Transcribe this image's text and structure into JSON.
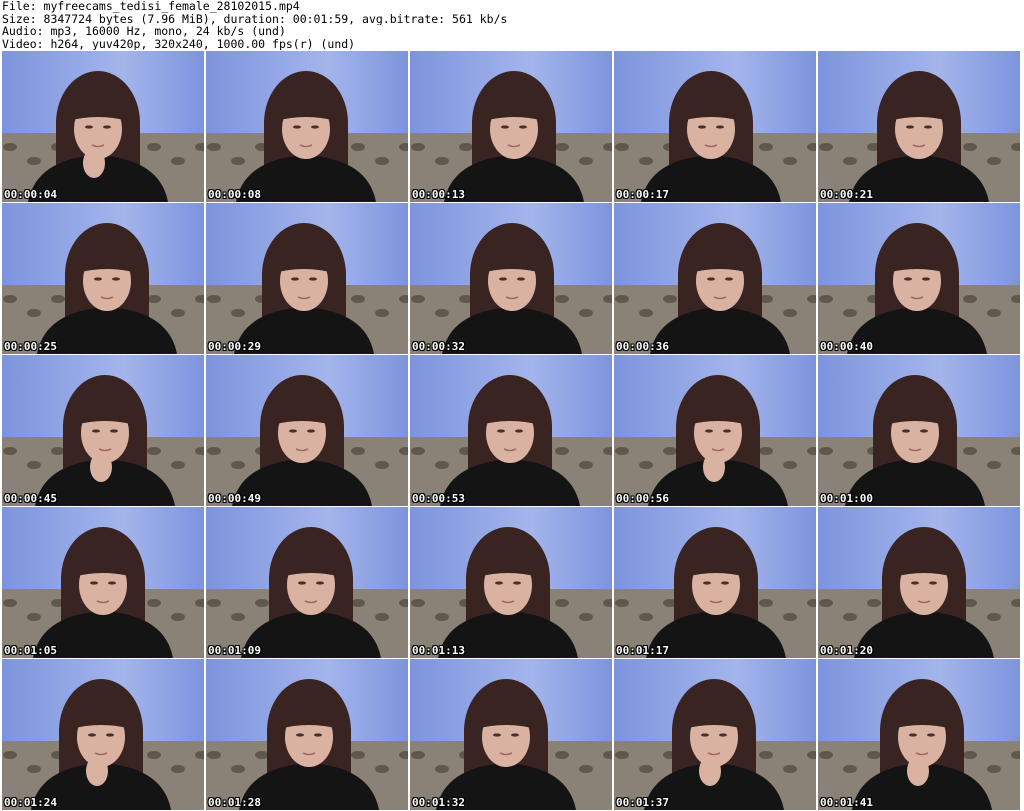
{
  "header": {
    "file_line": "File: myfreecams_tedisi_female_28102015.mp4",
    "size_line": "Size: 8347724 bytes (7.96 MiB), duration: 00:01:59, avg.bitrate: 561 kb/s",
    "audio_line": "Audio: mp3, 16000 Hz, mono, 24 kb/s (und)",
    "video_line": "Video: h264, yuv420p, 320x240, 1000.00 fps(r) (und)"
  },
  "colors": {
    "wall": "#7d94dd",
    "wall_light": "#a4b5ec",
    "hair": "#3a2422",
    "skin": "#d9b2a2",
    "shirt": "#141414",
    "sofa": "#8a8276",
    "sofa_pattern": "#4e463e",
    "timestamp": "#ffffff"
  },
  "thumbnails": [
    {
      "time": "00:00:04",
      "hand": true
    },
    {
      "time": "00:00:08",
      "hand": false
    },
    {
      "time": "00:00:13",
      "hand": false
    },
    {
      "time": "00:00:17",
      "hand": false
    },
    {
      "time": "00:00:21",
      "hand": false
    },
    {
      "time": "00:00:25",
      "hand": false
    },
    {
      "time": "00:00:29",
      "hand": false
    },
    {
      "time": "00:00:32",
      "hand": false
    },
    {
      "time": "00:00:36",
      "hand": false
    },
    {
      "time": "00:00:40",
      "hand": false
    },
    {
      "time": "00:00:45",
      "hand": true
    },
    {
      "time": "00:00:49",
      "hand": false
    },
    {
      "time": "00:00:53",
      "hand": false
    },
    {
      "time": "00:00:56",
      "hand": true
    },
    {
      "time": "00:01:00",
      "hand": false
    },
    {
      "time": "00:01:05",
      "hand": false
    },
    {
      "time": "00:01:09",
      "hand": false
    },
    {
      "time": "00:01:13",
      "hand": false
    },
    {
      "time": "00:01:17",
      "hand": false
    },
    {
      "time": "00:01:20",
      "hand": false
    },
    {
      "time": "00:01:24",
      "hand": true
    },
    {
      "time": "00:01:28",
      "hand": false
    },
    {
      "time": "00:01:32",
      "hand": false
    },
    {
      "time": "00:01:37",
      "hand": true
    },
    {
      "time": "00:01:41",
      "hand": true
    }
  ]
}
